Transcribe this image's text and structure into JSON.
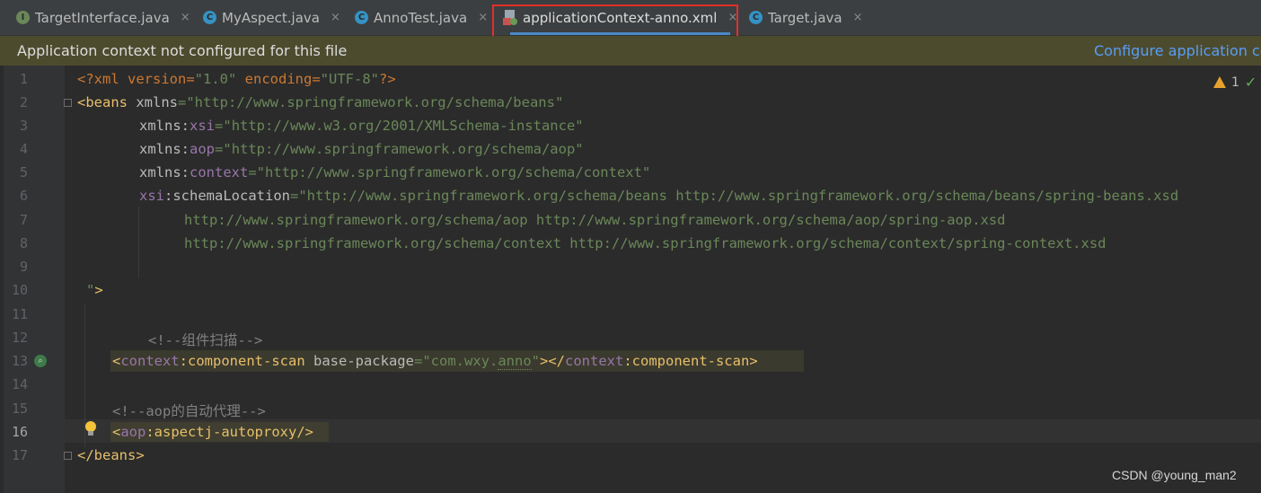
{
  "tabs": [
    {
      "label": "TargetInterface.java",
      "icon": "interface-icon",
      "icon_letter": "I",
      "active": false
    },
    {
      "label": "MyAspect.java",
      "icon": "class-icon",
      "icon_letter": "C",
      "active": false
    },
    {
      "label": "AnnoTest.java",
      "icon": "class-run-icon",
      "icon_letter": "C",
      "active": false
    },
    {
      "label": "applicationContext-anno.xml",
      "icon": "xml-file-icon",
      "active": true
    },
    {
      "label": "Target.java",
      "icon": "class-icon",
      "icon_letter": "C",
      "active": false
    }
  ],
  "tab_close_glyph": "×",
  "banner": {
    "message": "Application context not configured for this file",
    "link": "Configure application con"
  },
  "inspection": {
    "warning_count": "1",
    "check_glyph": "✓"
  },
  "line_numbers": [
    "1",
    "2",
    "3",
    "4",
    "5",
    "6",
    "7",
    "8",
    "9",
    "10",
    "11",
    "12",
    "13",
    "14",
    "15",
    "16",
    "17"
  ],
  "current_line": "16",
  "code": {
    "l1": {
      "a": "<?xml version=",
      "b": "\"1.0\"",
      "c": " encoding=",
      "d": "\"UTF-8\"",
      "e": "?>"
    },
    "l2": {
      "a": "<beans",
      "b": " xmlns",
      "c": "=",
      "d": "\"http://www.springframework.org/schema/beans\""
    },
    "l3": {
      "a": "xmlns",
      "b": ":",
      "c": "xsi",
      "d": "=",
      "e": "\"http://www.w3.org/2001/XMLSchema-instance\""
    },
    "l4": {
      "a": "xmlns",
      "b": ":",
      "c": "aop",
      "d": "=",
      "e": "\"http://www.springframework.org/schema/aop\""
    },
    "l5": {
      "a": "xmlns",
      "b": ":",
      "c": "context",
      "d": "=",
      "e": "\"http://www.springframework.org/schema/context\""
    },
    "l6": {
      "a": "xsi",
      "b": ":schemaLocation",
      "c": "=",
      "d": "\"http://www.springframework.org/schema/beans http://www.springframework.org/schema/beans/spring-beans.xsd"
    },
    "l7": "http://www.springframework.org/schema/aop http://www.springframework.org/schema/aop/spring-aop.xsd",
    "l8": "http://www.springframework.org/schema/context http://www.springframework.org/schema/context/spring-context.xsd",
    "l10": {
      "a": "\"",
      "b": ">"
    },
    "l12": "<!--组件扫描-->",
    "l13": {
      "a": "<",
      "b": "context",
      "c": ":component-scan",
      "d": " base-package",
      "e": "=",
      "f": "\"com.wxy.",
      "g": "anno",
      "h": "\"",
      "i": "></",
      "j": "context",
      "k": ":component-scan",
      "l": ">"
    },
    "l15": "<!--aop的自动代理-->",
    "l16": {
      "a": "<",
      "b": "aop",
      "c": ":aspectj-autoproxy",
      "d": "/>"
    },
    "l17": "</beans>"
  },
  "watermark": "CSDN @young_man2",
  "colors": {
    "background": "#2b2b2b",
    "tag": "#e8bf6a",
    "namespace": "#9876aa",
    "string": "#6a8759",
    "comment": "#808080",
    "link": "#589df6",
    "banner": "#4d4b2e",
    "highlight_box": "#e0302b"
  }
}
